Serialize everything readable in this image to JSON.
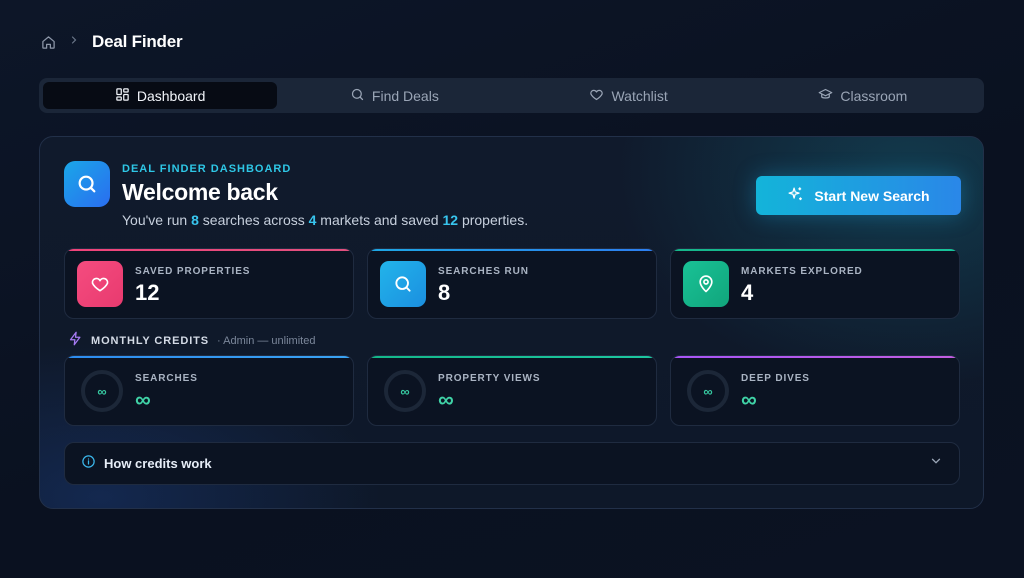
{
  "breadcrumb": {
    "home_icon": "home-icon",
    "separator_icon": "chevron-right-icon",
    "title": "Deal Finder"
  },
  "tabs": [
    {
      "label": "Dashboard",
      "icon": "grid-icon",
      "active": true
    },
    {
      "label": "Find Deals",
      "icon": "search-icon",
      "active": false
    },
    {
      "label": "Watchlist",
      "icon": "heart-icon",
      "active": false
    },
    {
      "label": "Classroom",
      "icon": "graduation-cap-icon",
      "active": false
    }
  ],
  "hero": {
    "kicker": "DEAL FINDER DASHBOARD",
    "title": "Welcome back",
    "summary": {
      "part1": "You've run ",
      "searches": "8",
      "part2": " searches across ",
      "markets": "4",
      "part3": " markets and saved ",
      "saved": "12",
      "part4": " properties."
    },
    "start_button": "Start New Search"
  },
  "stats": [
    {
      "label": "SAVED PROPERTIES",
      "value": "12",
      "icon": "heart-icon",
      "color": "#f0437a"
    },
    {
      "label": "SEARCHES RUN",
      "value": "8",
      "icon": "search-icon",
      "color": "#1ea7e4"
    },
    {
      "label": "MARKETS EXPLORED",
      "value": "4",
      "icon": "map-pin-icon",
      "color": "#16b58a"
    }
  ],
  "credits": {
    "title": "MONTHLY CREDITS",
    "note": "· Admin — unlimited",
    "items": [
      {
        "label": "SEARCHES",
        "value": "∞",
        "ring": "∞",
        "accent": "#2d8cf0"
      },
      {
        "label": "PROPERTY VIEWS",
        "value": "∞",
        "ring": "∞",
        "accent": "#14b88a"
      },
      {
        "label": "DEEP DIVES",
        "value": "∞",
        "ring": "∞",
        "accent": "#a855f7"
      }
    ]
  },
  "accordion": {
    "title": "How credits work",
    "icon": "info-icon",
    "toggle_icon": "chevron-down-icon"
  }
}
